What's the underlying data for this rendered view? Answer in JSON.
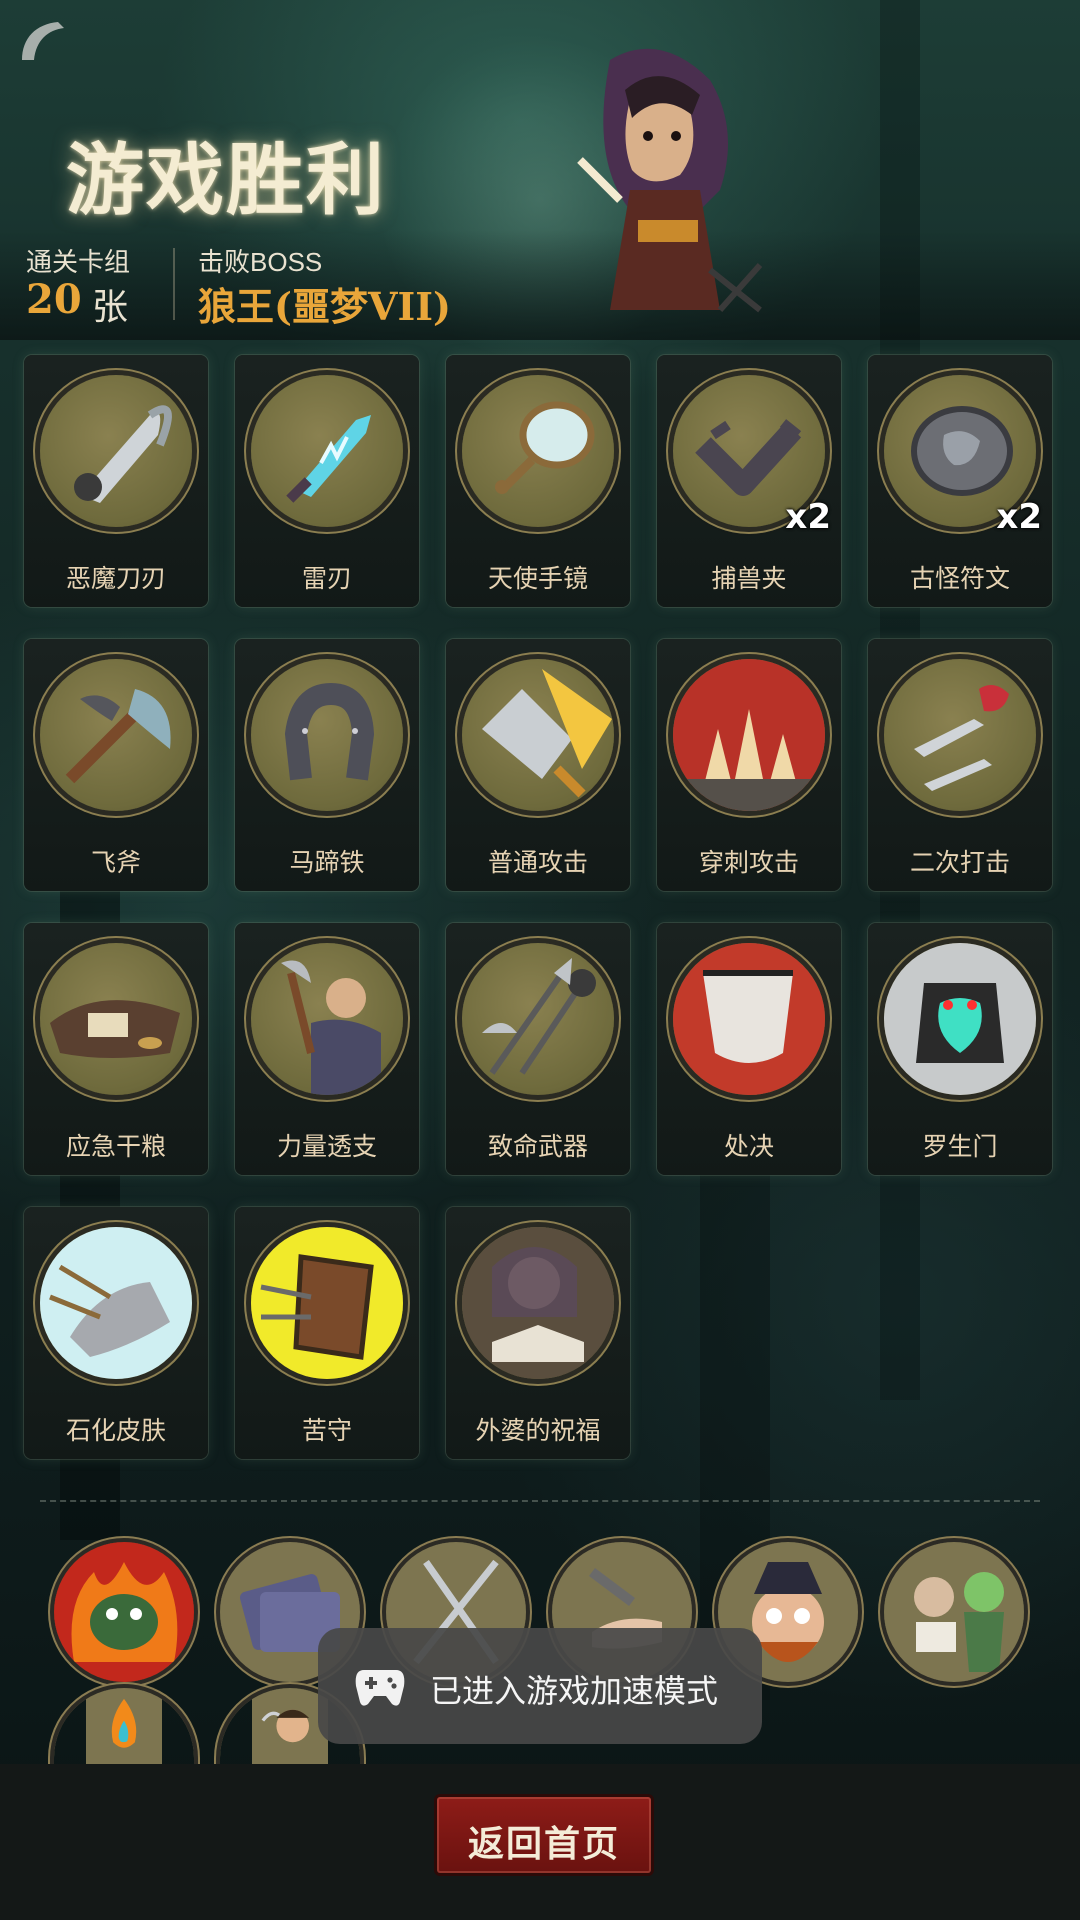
{
  "header": {
    "title": "游戏胜利",
    "cleared_deck_label": "通关卡组",
    "cleared_deck_count": "20",
    "cleared_deck_unit": "张",
    "defeated_boss_label": "击败BOSS",
    "defeated_boss_name": "狼王(噩梦VII)"
  },
  "cards": [
    {
      "name": "恶魔刀刃",
      "icon": "demon-blade-icon",
      "badge": ""
    },
    {
      "name": "雷刃",
      "icon": "thunder-blade-icon",
      "badge": ""
    },
    {
      "name": "天使手镜",
      "icon": "angel-mirror-icon",
      "badge": ""
    },
    {
      "name": "捕兽夹",
      "icon": "bear-trap-icon",
      "badge": "x2"
    },
    {
      "name": "古怪符文",
      "icon": "strange-rune-icon",
      "badge": "x2"
    },
    {
      "name": "飞斧",
      "icon": "flying-axe-icon",
      "badge": ""
    },
    {
      "name": "马蹄铁",
      "icon": "horseshoe-icon",
      "badge": ""
    },
    {
      "name": "普通攻击",
      "icon": "normal-attack-icon",
      "badge": ""
    },
    {
      "name": "穿刺攻击",
      "icon": "pierce-attack-icon",
      "badge": ""
    },
    {
      "name": "二次打击",
      "icon": "double-strike-icon",
      "badge": ""
    },
    {
      "name": "应急干粮",
      "icon": "emergency-rations-icon",
      "badge": ""
    },
    {
      "name": "力量透支",
      "icon": "power-overdraw-icon",
      "badge": ""
    },
    {
      "name": "致命武器",
      "icon": "deadly-weapons-icon",
      "badge": ""
    },
    {
      "name": "处决",
      "icon": "execution-icon",
      "badge": ""
    },
    {
      "name": "罗生门",
      "icon": "rashomon-icon",
      "badge": ""
    },
    {
      "name": "石化皮肤",
      "icon": "stone-skin-icon",
      "badge": ""
    },
    {
      "name": "苦守",
      "icon": "hard-defense-icon",
      "badge": ""
    },
    {
      "name": "外婆的祝福",
      "icon": "grandma-blessing-icon",
      "badge": ""
    }
  ],
  "relics": [
    {
      "icon": "fire-demon-icon"
    },
    {
      "icon": "card-pack-icon"
    },
    {
      "icon": "crossed-blades-icon"
    },
    {
      "icon": "hand-gift-icon"
    },
    {
      "icon": "scared-pirate-icon"
    },
    {
      "icon": "zombie-reader-icon"
    },
    {
      "icon": "flame-spark-icon"
    },
    {
      "icon": "laughing-thief-icon"
    }
  ],
  "toast": {
    "text": "已进入游戏加速模式",
    "icon": "gamepad-icon"
  },
  "footer": {
    "home_button": "返回首页"
  },
  "colors": {
    "accent_gold": "#e9a63a",
    "button_red": "#8e1c18",
    "card_circle": "#7a744a"
  }
}
